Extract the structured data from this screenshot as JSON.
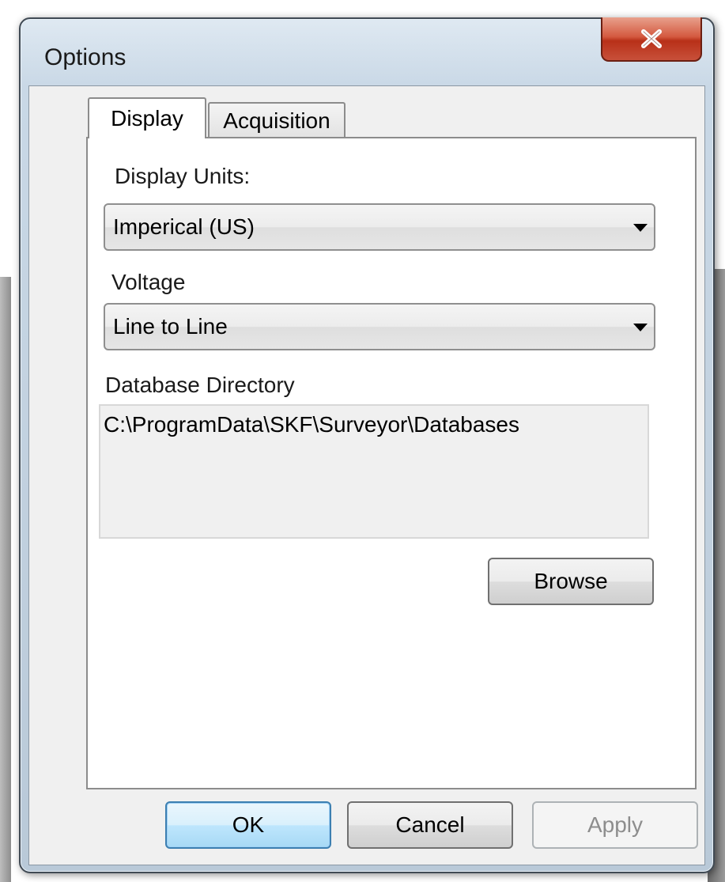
{
  "window": {
    "title": "Options"
  },
  "tabs": [
    {
      "label": "Display",
      "selected": true
    },
    {
      "label": "Acquisition",
      "selected": false
    }
  ],
  "display": {
    "units_label": "Display Units:",
    "units_value": "Imperical (US)",
    "voltage_label": "Voltage",
    "voltage_value": "Line to Line",
    "db_dir_label": "Database Directory",
    "db_dir_value": "C:\\ProgramData\\SKF\\Surveyor\\Databases",
    "browse_label": "Browse"
  },
  "footer": {
    "ok_label": "OK",
    "cancel_label": "Cancel",
    "apply_label": "Apply"
  },
  "colors": {
    "close_button": "#c8503a",
    "default_button_border": "#3c7fb1"
  }
}
